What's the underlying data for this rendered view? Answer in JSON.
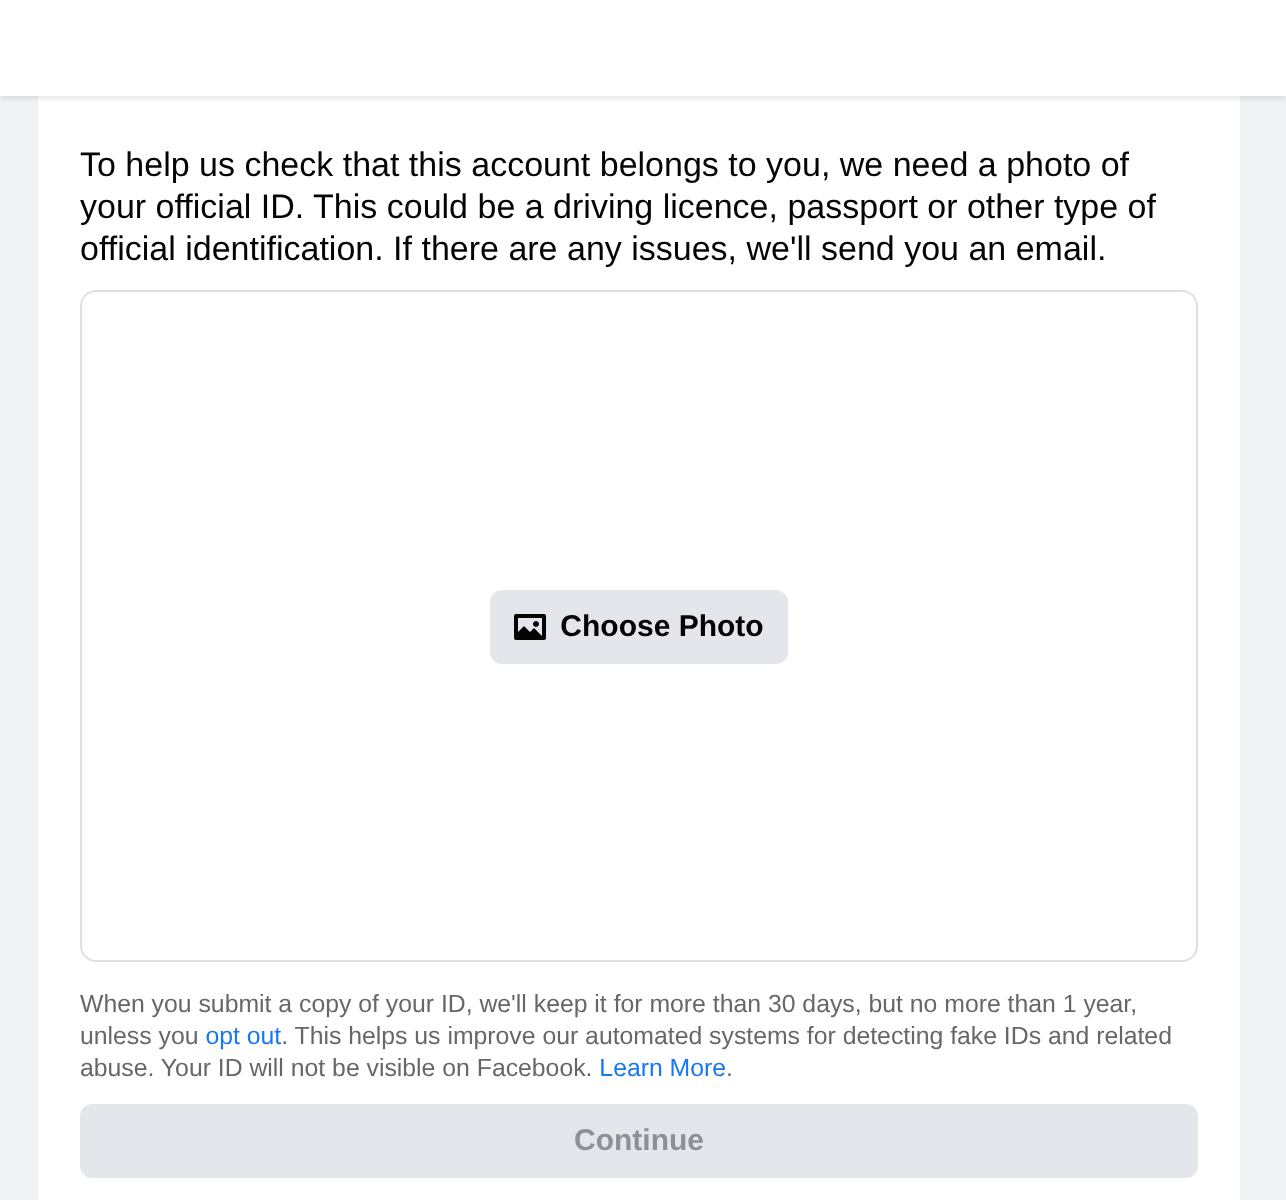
{
  "description": "To help us check that this account belongs to you, we need a photo of your official ID. This could be a driving licence, passport or other type of official identification. If there are any issues, we'll send you an email.",
  "upload": {
    "button": "Choose Photo"
  },
  "notice": [
    {
      "kind": "text",
      "text": "When you submit a copy of your ID, we'll keep it for more than 30 days, but no more than 1 year, unless you "
    },
    {
      "kind": "link",
      "text": "opt out"
    },
    {
      "kind": "text",
      "text": ". This helps us improve our automated systems for detecting fake IDs and related abuse. Your ID will not be visible on Facebook. "
    },
    {
      "kind": "link",
      "text": "Learn More"
    },
    {
      "kind": "text",
      "text": "."
    }
  ],
  "continue_button": {
    "label": "Continue",
    "disabled": true
  }
}
